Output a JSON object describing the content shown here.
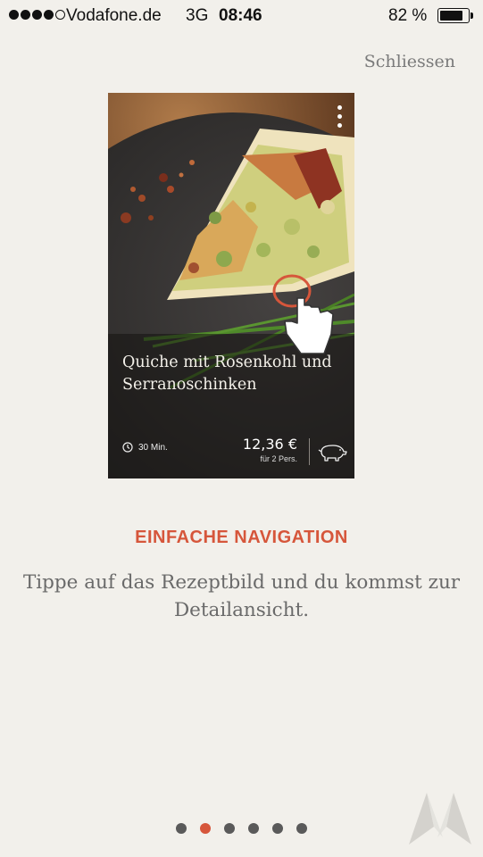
{
  "status_bar": {
    "carrier": "Vodafone.de",
    "network": "3G",
    "time": "08:46",
    "battery_percent": "82 %",
    "battery_level": 0.82,
    "signal_bars_filled": 4,
    "signal_bars_total": 5
  },
  "header": {
    "close_label": "Schliessen"
  },
  "recipe_card": {
    "title": "Quiche mit Rosenkohl und Serranoschinken",
    "duration": "30 Min.",
    "price": "12,36 €",
    "portion": "für 2 Pers.",
    "menu_icon": "more-vertical-icon",
    "diet_icon": "pig-icon",
    "clock_icon": "clock-icon"
  },
  "onboarding": {
    "headline": "EINFACHE NAVIGATION",
    "description": "Tippe auf das Rezeptbild und du kommst zur Detailansicht."
  },
  "pager": {
    "total": 6,
    "active_index": 1
  },
  "colors": {
    "accent": "#d6563b",
    "background": "#f2f0eb",
    "text_muted": "#6a6a6a"
  }
}
